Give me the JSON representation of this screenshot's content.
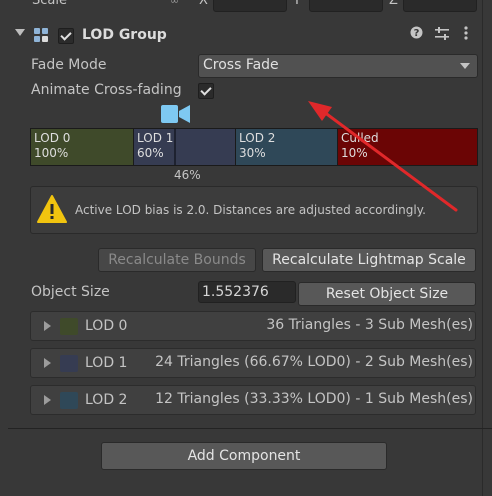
{
  "scale_row": {
    "label": "Scale",
    "axes": [
      "X",
      "Y",
      "Z"
    ]
  },
  "header": {
    "title": "LOD Group",
    "enabled": true,
    "icons": [
      "help-icon",
      "preset-icon",
      "more-icon"
    ]
  },
  "fade_mode": {
    "label": "Fade Mode",
    "value": "Cross Fade"
  },
  "animate": {
    "label": "Animate Cross-fading",
    "checked": true
  },
  "lod_bar": {
    "segments": [
      {
        "name": "LOD 0",
        "pct": "100%",
        "color": "#3f4a2a"
      },
      {
        "name": "LOD 1",
        "pct": "60%",
        "color": "#363c52"
      },
      {
        "name": "LOD 2",
        "pct": "30%",
        "color": "#2f4858"
      },
      {
        "name": "Culled",
        "pct": "10%",
        "color": "#6b0505"
      }
    ],
    "marker": "46%"
  },
  "help": {
    "text": "Active LOD bias is 2.0. Distances are adjusted accordingly."
  },
  "buttons": {
    "recalc_bounds": "Recalculate Bounds",
    "recalc_lightmap": "Recalculate Lightmap Scale",
    "reset_size": "Reset Object Size",
    "add_component": "Add Component"
  },
  "object_size": {
    "label": "Object Size",
    "value": "1.552376"
  },
  "lods": [
    {
      "name": "LOD 0",
      "info": "36 Triangles  - 3 Sub Mesh(es)",
      "color": "#3f4a2a"
    },
    {
      "name": "LOD 1",
      "info": "24 Triangles (66.67% LOD0) - 2 Sub Mesh(es)",
      "color": "#363c52"
    },
    {
      "name": "LOD 2",
      "info": "12 Triangles (33.33% LOD0) - 1 Sub Mesh(es)",
      "color": "#2f4858"
    }
  ],
  "colors": {
    "annotation_arrow": "#e0282a",
    "warning": "#f1c40f",
    "camera": "#7ec9f2"
  }
}
